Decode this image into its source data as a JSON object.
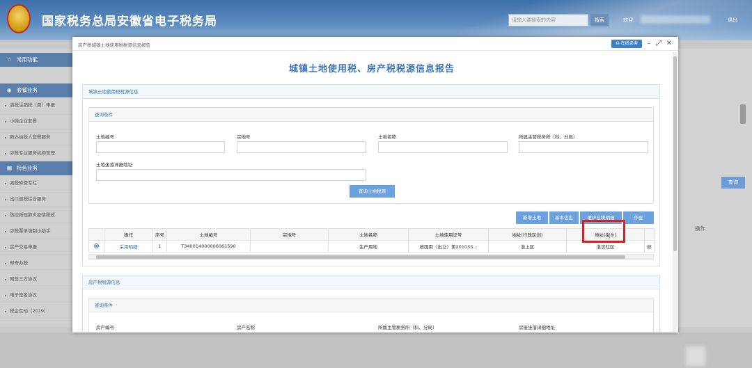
{
  "header": {
    "title": "国家税务总局安徽省电子税务局",
    "search_placeholder": "请输入要搜索的内容",
    "search_label": "搜索",
    "welcome": "欢迎,",
    "logout": "退出"
  },
  "sidebar": {
    "sections": [
      {
        "title": "常用功能",
        "icon": "star-icon",
        "items": []
      },
      {
        "title": "套餐业务",
        "icon": "package-icon",
        "items": [
          "清税注销税（费）申报",
          "小微企业套餐",
          "新办纳税人套餐服务",
          "涉税专业服务机构管理"
        ]
      },
      {
        "title": "特色业务",
        "icon": "grid-icon",
        "items": [
          "减税降费专栏",
          "出口退税综合服务",
          "防控新冠肺炎疫情税收",
          "涉税票单填制小助手",
          "房产交易申报",
          "邮寄办税",
          "网签三方协议",
          "电子签名协议",
          "税企互动（2019）"
        ]
      }
    ]
  },
  "right_panel": {
    "query_label": "查询",
    "op_label": "操作"
  },
  "modal": {
    "title": "房产税城镇土地使用税税源信息报告",
    "online_consult": "在线咨询",
    "icons": {
      "minimize": "minimize-icon",
      "maximize": "maximize-icon",
      "close": "close-icon"
    },
    "report_title": "城镇土地使用税、房产税税源信息报告",
    "land_panel": {
      "title": "城镇土地使用税税源信息",
      "query_title": "查询条件",
      "fields": {
        "land_no": "土地编号",
        "parcel_no": "宗地号",
        "land_name": "土地名称",
        "tax_office": "所属主管税务所（科、分局）",
        "address": "土地坐落详细地址"
      },
      "query_button": "查询土地税源",
      "actions": [
        "新增土地",
        "基本信息",
        "维护应税明细",
        "作废"
      ],
      "columns": [
        "操作",
        "序号",
        "土地编号",
        "宗地号",
        "土地名称",
        "土地使用证号",
        "地址(行政区划)",
        "地址(街乡)"
      ],
      "row": {
        "op": "采用明细",
        "seq": "1",
        "land_no": "T340014000006061590",
        "parcel_no": "",
        "land_name": "生产用地",
        "cert_no": "蚌国用（出让）第201033...",
        "district": "淮上区",
        "street": "淮滨社区"
      },
      "trailing_cell": "蚌"
    },
    "house_panel": {
      "title": "房产税税源信息",
      "query_title": "查询条件",
      "fields": {
        "house_no": "房产编号",
        "house_name": "房产名称",
        "tax_office": "所属主管税务所（科、分局）",
        "address": "房屋坐落详细地址"
      }
    }
  }
}
